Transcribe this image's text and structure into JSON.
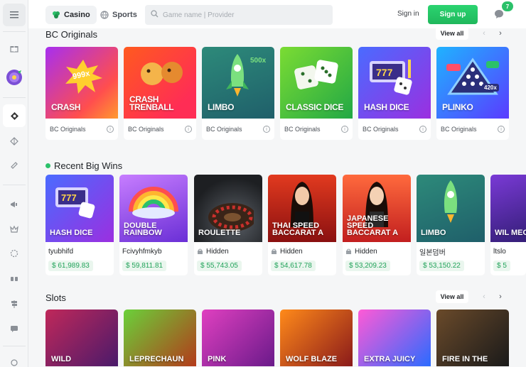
{
  "header": {
    "tabs": [
      {
        "label": "Casino",
        "icon": "casino-clover-icon"
      },
      {
        "label": "Sports",
        "icon": "sports-ball-icon"
      }
    ],
    "search_placeholder": "Game name | Provider",
    "signin_label": "Sign in",
    "signup_label": "Sign up",
    "chat_badge": "7",
    "accent": "#2bc16a"
  },
  "sidebar": {
    "items": [
      "menu-icon",
      "gift-icon",
      "spin-wheel-icon",
      "lottery-icon",
      "shell-icon",
      "coupon-icon",
      "megaphone-icon",
      "crown-icon",
      "loading-ring-icon",
      "handshake-icon",
      "signpost-icon",
      "chat-icon"
    ]
  },
  "bc_originals": {
    "title": "BC Originals",
    "view_all": "View all",
    "prev": "‹",
    "next": "›",
    "games": [
      {
        "name": "CRASH",
        "provider": "BC Originals",
        "badge": "999x"
      },
      {
        "name": "CRASH TRENBALL",
        "provider": "BC Originals"
      },
      {
        "name": "LIMBO",
        "provider": "BC Originals",
        "badge": "500x"
      },
      {
        "name": "CLASSIC DICE",
        "provider": "BC Originals"
      },
      {
        "name": "HASH DICE",
        "provider": "BC Originals"
      },
      {
        "name": "PLINKO",
        "provider": "BC Originals",
        "badge": "420x"
      }
    ]
  },
  "recent_wins": {
    "title": "Recent Big Wins",
    "wins": [
      {
        "game": "HASH DICE",
        "user": "tyubhifd",
        "amount": "$ 61,989.83",
        "hidden": false
      },
      {
        "game": "DOUBLE RAINBOW",
        "user": "Fcivyhfmkyb",
        "amount": "$ 59,811.81",
        "hidden": false
      },
      {
        "game": "ROULETTE",
        "user": "Hidden",
        "amount": "$ 55,743.05",
        "hidden": true
      },
      {
        "game": "THAI SPEED BACCARAT A",
        "user": "Hidden",
        "amount": "$ 54,617.78",
        "hidden": true
      },
      {
        "game": "JAPANESE SPEED BACCARAT A",
        "user": "Hidden",
        "amount": "$ 53,209.23",
        "hidden": true
      },
      {
        "game": "LIMBO",
        "user": "일본덤버",
        "amount": "$ 53,150.22",
        "hidden": false
      },
      {
        "game": "WIL MEG",
        "user": "ltslo",
        "amount": "$ 5",
        "hidden": false
      }
    ]
  },
  "slots": {
    "title": "Slots",
    "view_all": "View all",
    "prev": "‹",
    "next": "›",
    "games": [
      "WILD",
      "LEPRECHAUN",
      "PINK",
      "WOLF BLAZE",
      "EXTRA JUICY",
      "FIRE IN THE"
    ]
  }
}
